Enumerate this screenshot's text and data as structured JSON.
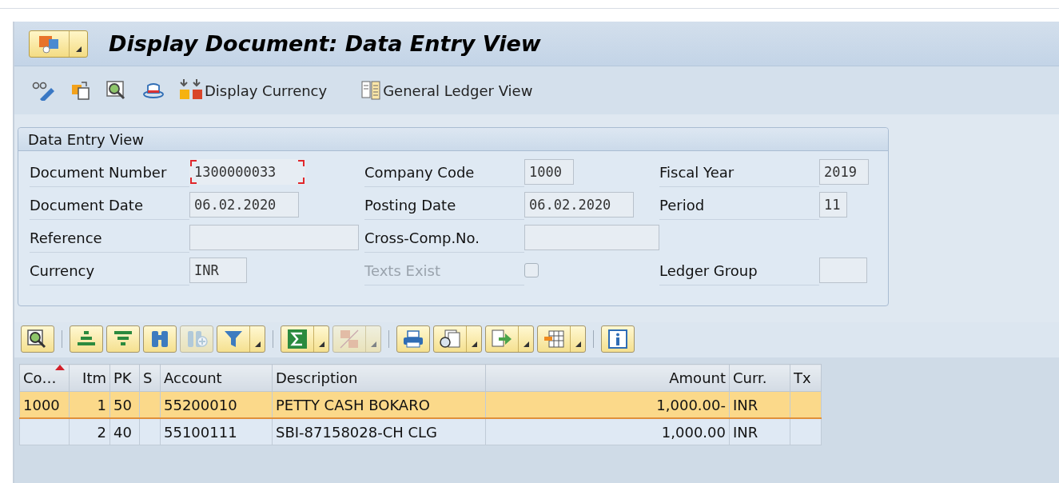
{
  "window": {
    "title": "Display Document: Data Entry View"
  },
  "toolbar": {
    "items": [
      {
        "label": "Display Currency"
      },
      {
        "label": "General Ledger View"
      }
    ]
  },
  "header_group": {
    "title": "Data Entry View",
    "rows": [
      [
        {
          "kind": "field",
          "label": "Document Number",
          "value": "1300000033",
          "focused": true
        },
        {
          "kind": "field",
          "label": "Company Code",
          "value": "1000",
          "focused": false
        },
        {
          "kind": "field",
          "label": "Fiscal Year",
          "value": "2019",
          "focused": false
        }
      ],
      [
        {
          "kind": "field",
          "label": "Document Date",
          "value": "06.02.2020",
          "focused": false
        },
        {
          "kind": "field",
          "label": "Posting Date",
          "value": "06.02.2020",
          "focused": false
        },
        {
          "kind": "field",
          "label": "Period",
          "value": "11",
          "focused": false
        }
      ],
      [
        {
          "kind": "field",
          "label": "Reference",
          "focused": false
        },
        {
          "kind": "field",
          "label": "Cross-Comp.No.",
          "focused": false
        }
      ],
      [
        {
          "kind": "field",
          "label": "Currency",
          "value": "INR",
          "focused": false
        },
        {
          "kind": "checkbox",
          "label": "Texts Exist",
          "checked": false,
          "disabled": true
        },
        {
          "kind": "field",
          "label": "Ledger Group",
          "focused": false
        }
      ]
    ]
  },
  "grid_toolbar": {
    "groups": [
      {
        "buttons": [
          {
            "has_menu": false,
            "disabled": false
          }
        ]
      },
      {
        "buttons": [
          {
            "has_menu": false,
            "disabled": false
          },
          {
            "has_menu": false,
            "disabled": false
          },
          {
            "has_menu": false,
            "disabled": false
          },
          {
            "has_menu": false,
            "disabled": true
          },
          {
            "has_menu": true,
            "disabled": false
          }
        ]
      },
      {
        "buttons": [
          {
            "has_menu": true,
            "disabled": false
          },
          {
            "has_menu": true,
            "disabled": true
          }
        ]
      },
      {
        "buttons": [
          {
            "has_menu": false,
            "disabled": false
          },
          {
            "has_menu": true,
            "disabled": false
          },
          {
            "has_menu": true,
            "disabled": false
          },
          {
            "has_menu": true,
            "disabled": false
          }
        ]
      },
      {
        "buttons": [
          {
            "has_menu": false,
            "disabled": false
          }
        ]
      }
    ]
  },
  "table": {
    "columns": [
      {
        "label": "Co…",
        "sorted": true
      },
      {
        "label": "Itm",
        "sorted": false
      },
      {
        "label": "PK",
        "sorted": false
      },
      {
        "label": "S",
        "sorted": false
      },
      {
        "label": "Account",
        "sorted": false
      },
      {
        "label": "Description",
        "sorted": false
      },
      {
        "label": "Amount",
        "sorted": false
      },
      {
        "label": "Curr.",
        "sorted": false
      },
      {
        "label": "Tx",
        "sorted": false
      }
    ],
    "rows": [
      {
        "selected": true,
        "cells": [
          "1000",
          "1",
          "50",
          "",
          "55200010",
          "PETTY CASH BOKARO",
          "1,000.00-",
          "INR",
          ""
        ]
      },
      {
        "selected": false,
        "cells": [
          "",
          "2",
          "40",
          "",
          "55100111",
          "SBI-87158028-CH CLG",
          "1,000.00",
          "INR",
          ""
        ]
      }
    ]
  }
}
